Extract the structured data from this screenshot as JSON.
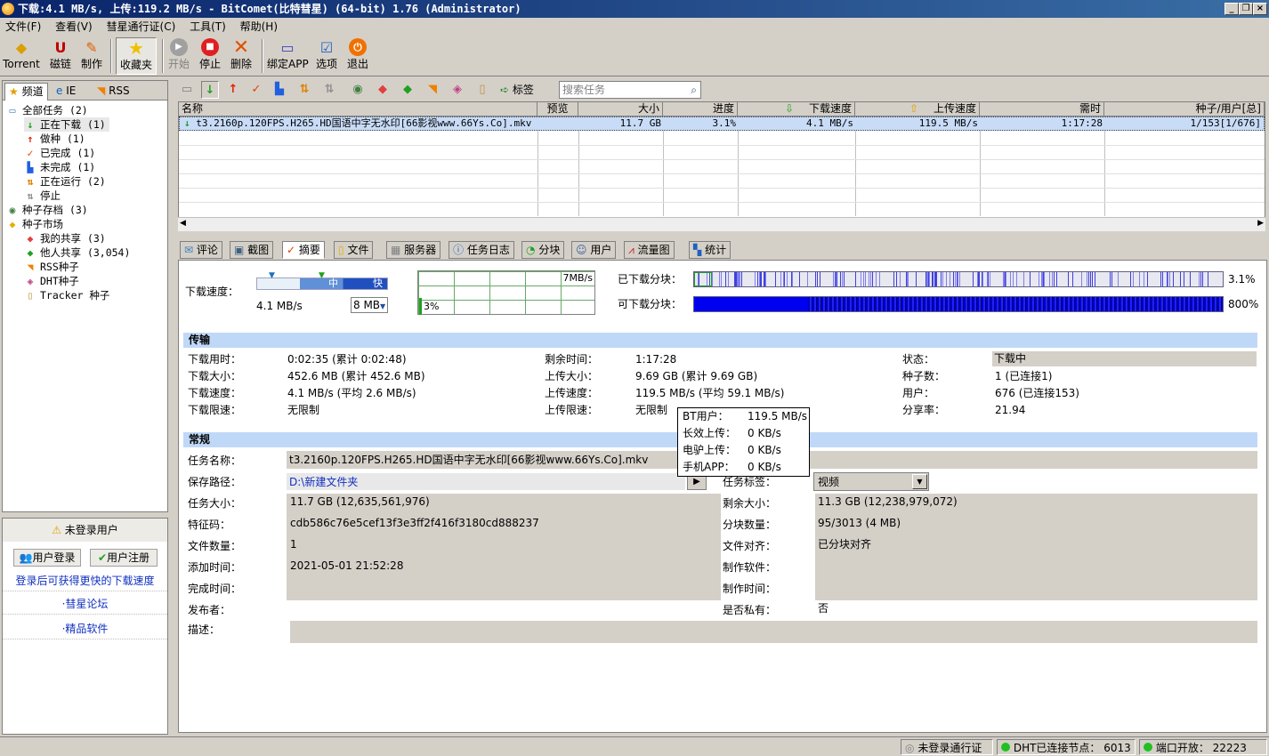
{
  "window": {
    "title": "下载:4.1 MB/s, 上传:119.2 MB/s - BitComet(比特彗星) (64-bit) 1.76 (Administrator)"
  },
  "menu": [
    "文件(F)",
    "查看(V)",
    "彗星通行证(C)",
    "工具(T)",
    "帮助(H)"
  ],
  "toolbar": {
    "torrent": "Torrent",
    "magnet": "磁链",
    "make": "制作",
    "favorites": "收藏夹",
    "start": "开始",
    "stop": "停止",
    "delete": "删除",
    "bind_app": "绑定APP",
    "options": "选项",
    "exit": "退出"
  },
  "left_tabs": {
    "channel": "频道",
    "ie": "IE",
    "rss": "RSS"
  },
  "tree": {
    "all": "全部任务",
    "all_count": "(2)",
    "downloading": "正在下载",
    "downloading_count": "(1)",
    "seeding": "做种",
    "seeding_count": "(1)",
    "completed": "已完成",
    "completed_count": "(1)",
    "incomplete": "未完成",
    "incomplete_count": "(1)",
    "running": "正在运行",
    "running_count": "(2)",
    "stopped": "停止",
    "archive": "种子存档",
    "archive_count": "(3)",
    "market": "种子市场",
    "my_share": "我的共享",
    "my_share_count": "(3)",
    "others_share": "他人共享",
    "others_share_count": "(3,054)",
    "rss_seeds": "RSS种子",
    "dht_seeds": "DHT种子",
    "tracker_seeds": "Tracker 种子"
  },
  "user_panel": {
    "not_logged": "未登录用户",
    "login": "用户登录",
    "register": "用户注册",
    "promo": "登录后可获得更快的下载速度",
    "forum": "·彗星论坛",
    "software": "·精品软件"
  },
  "task_toolbar": {
    "tags": "标签",
    "search_placeholder": "搜索任务"
  },
  "columns": [
    "名称",
    "预览",
    "大小",
    "进度",
    "下载速度",
    "上传速度",
    "需时",
    "种子/用户[总]"
  ],
  "tasks": [
    {
      "name": "t3.2160p.120FPS.H265.HD国语中字无水印[66影视www.66Ys.Co].mkv",
      "size": "11.7 GB",
      "progress": "3.1%",
      "down": "4.1 MB/s",
      "up": "119.5 MB/s",
      "eta": "1:17:28",
      "peers": "1/153[1/676]"
    }
  ],
  "detail_tabs": [
    "评论",
    "截图",
    "摘要",
    "文件",
    "服务器",
    "任务日志",
    "分块",
    "用户",
    "流量图",
    "统计"
  ],
  "summary": {
    "speed_label": "下载速度：",
    "speed_mid": "中",
    "speed_fast": "快",
    "current_speed": "4.1 MB/s",
    "limit_select": "8 MB",
    "graph_max": "7MB/s",
    "graph_pct": "3%",
    "downloaded_pieces": "已下载分块：",
    "downloaded_pct": "3.1%",
    "available_pieces": "可下载分块：",
    "available_pct": "800%",
    "progress_fraction": 0.031
  },
  "transfer": {
    "section": "传输",
    "dl_time_l": "下载用时：",
    "dl_time": "0:02:35 (累计 0:02:48)",
    "remain_l": "剩余时间：",
    "remain": "1:17:28",
    "state_l": "状态：",
    "state": "下载中",
    "dl_size_l": "下载大小：",
    "dl_size": "452.6 MB (累计 452.6 MB)",
    "ul_size_l": "上传大小：",
    "ul_size": "9.69 GB (累计 9.69 GB)",
    "seeds_l": "种子数：",
    "seeds": "1 (已连接1)",
    "dl_speed_l": "下载速度：",
    "dl_speed": "4.1 MB/s (平均 2.6 MB/s)",
    "ul_speed_l": "上传速度：",
    "ul_speed": "119.5 MB/s (平均 59.1 MB/s)",
    "users_l": "用户：",
    "users": "676 (已连接153)",
    "dl_limit_l": "下载限速：",
    "dl_limit": "无限制",
    "ul_limit_l": "上传限速：",
    "ul_limit": "无限制",
    "ratio_l": "分享率：",
    "ratio": "21.94"
  },
  "general": {
    "section": "常规",
    "name_l": "任务名称：",
    "name": "t3.2160p.120FPS.H265.HD国语中字无水印[66影视www.66Ys.Co].mkv",
    "path_l": "保存路径：",
    "path": "D:\\新建文件夹",
    "tag_l": "任务标签：",
    "tag": "视频",
    "size_l": "任务大小：",
    "size": "11.7 GB (12,635,561,976)",
    "remain_l": "剩余大小：",
    "remain": "11.3 GB (12,238,979,072)",
    "hash_l": "特征码：",
    "hash": "cdb586c76e5cef13f3e3ff2f416f3180cd888237",
    "pieces_l": "分块数量：",
    "pieces": "95/3013 (4 MB)",
    "files_l": "文件数量：",
    "files": "1",
    "align_l": "文件对齐：",
    "align": "已分块对齐",
    "added_l": "添加时间：",
    "added": "2021-05-01 21:52:28",
    "software_l": "制作软件：",
    "completed_l": "完成时间：",
    "made_l": "制作时间：",
    "publisher_l": "发布者：",
    "private_l": "是否私有：",
    "private": "否",
    "desc_l": "描述："
  },
  "tooltip": {
    "bt_l": "BT用户：",
    "bt": "119.5 MB/s",
    "lt_l": "长效上传：",
    "lt": "0 KB/s",
    "dl_l": "电驴上传：",
    "dl": "0 KB/s",
    "app_l": "手机APP：",
    "app": "0 KB/s"
  },
  "statusbar": {
    "passport": "未登录通行证",
    "dht": "DHT已连接节点：",
    "dht_count": "6013",
    "port": "端口开放：",
    "port_num": "22223"
  },
  "colors": {
    "accent": "#0a246a",
    "selected_row": "#c8dcf8",
    "piece_blue": "#0000ff",
    "graph_green": "#008000"
  }
}
